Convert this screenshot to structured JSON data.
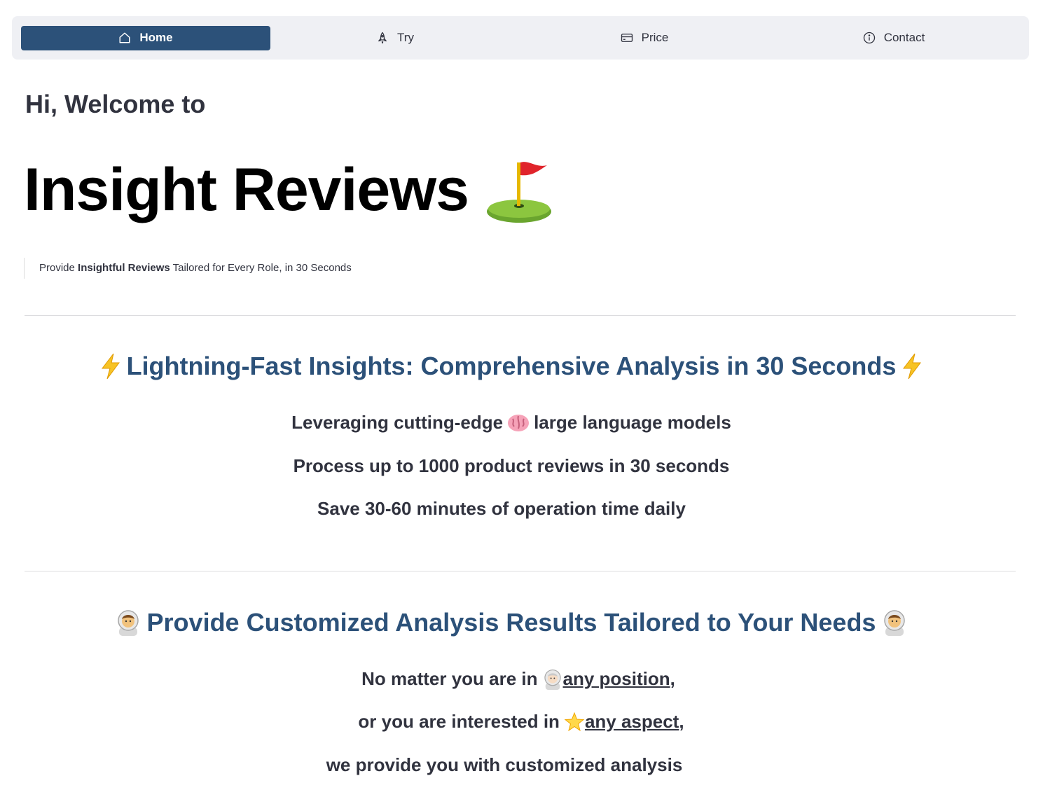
{
  "nav": {
    "items": [
      {
        "label": "Home",
        "icon": "home-icon",
        "active": true
      },
      {
        "label": "Try",
        "icon": "rocket-icon",
        "active": false
      },
      {
        "label": "Price",
        "icon": "credit-card-icon",
        "active": false
      },
      {
        "label": "Contact",
        "icon": "info-icon",
        "active": false
      }
    ]
  },
  "hero": {
    "welcome": "Hi, Welcome to",
    "title": "Insight Reviews",
    "title_icon": "golf-flag-icon",
    "tagline_prefix": "Provide ",
    "tagline_bold": "Insightful Reviews",
    "tagline_suffix": " Tailored for Every Role, in 30 Seconds"
  },
  "section1": {
    "heading": "Lightning-Fast Insights: Comprehensive Analysis in 30 Seconds",
    "heading_icon": "lightning-icon",
    "line1_a": "Leveraging cutting-edge",
    "line1_b": "large language models",
    "line1_icon": "brain-icon",
    "line2": "Process up to 1000 product reviews in 30 seconds",
    "line3": "Save 30-60 minutes of operation time daily"
  },
  "section2": {
    "heading": "Provide Customized Analysis Results Tailored to Your Needs",
    "heading_icon": "astronaut-icon",
    "line1_a": "No matter you are in",
    "line1_link": "any position",
    "line1_end": ",",
    "line1_icon": "astronaut-icon",
    "line2_a": "or you are interested in",
    "line2_link": "any aspect",
    "line2_end": ",",
    "line2_icon": "glowing-star-icon",
    "line3": "we provide you with customized analysis"
  },
  "colors": {
    "accent": "#2c5179",
    "nav_bg": "#eff0f4",
    "text": "#31333f"
  }
}
